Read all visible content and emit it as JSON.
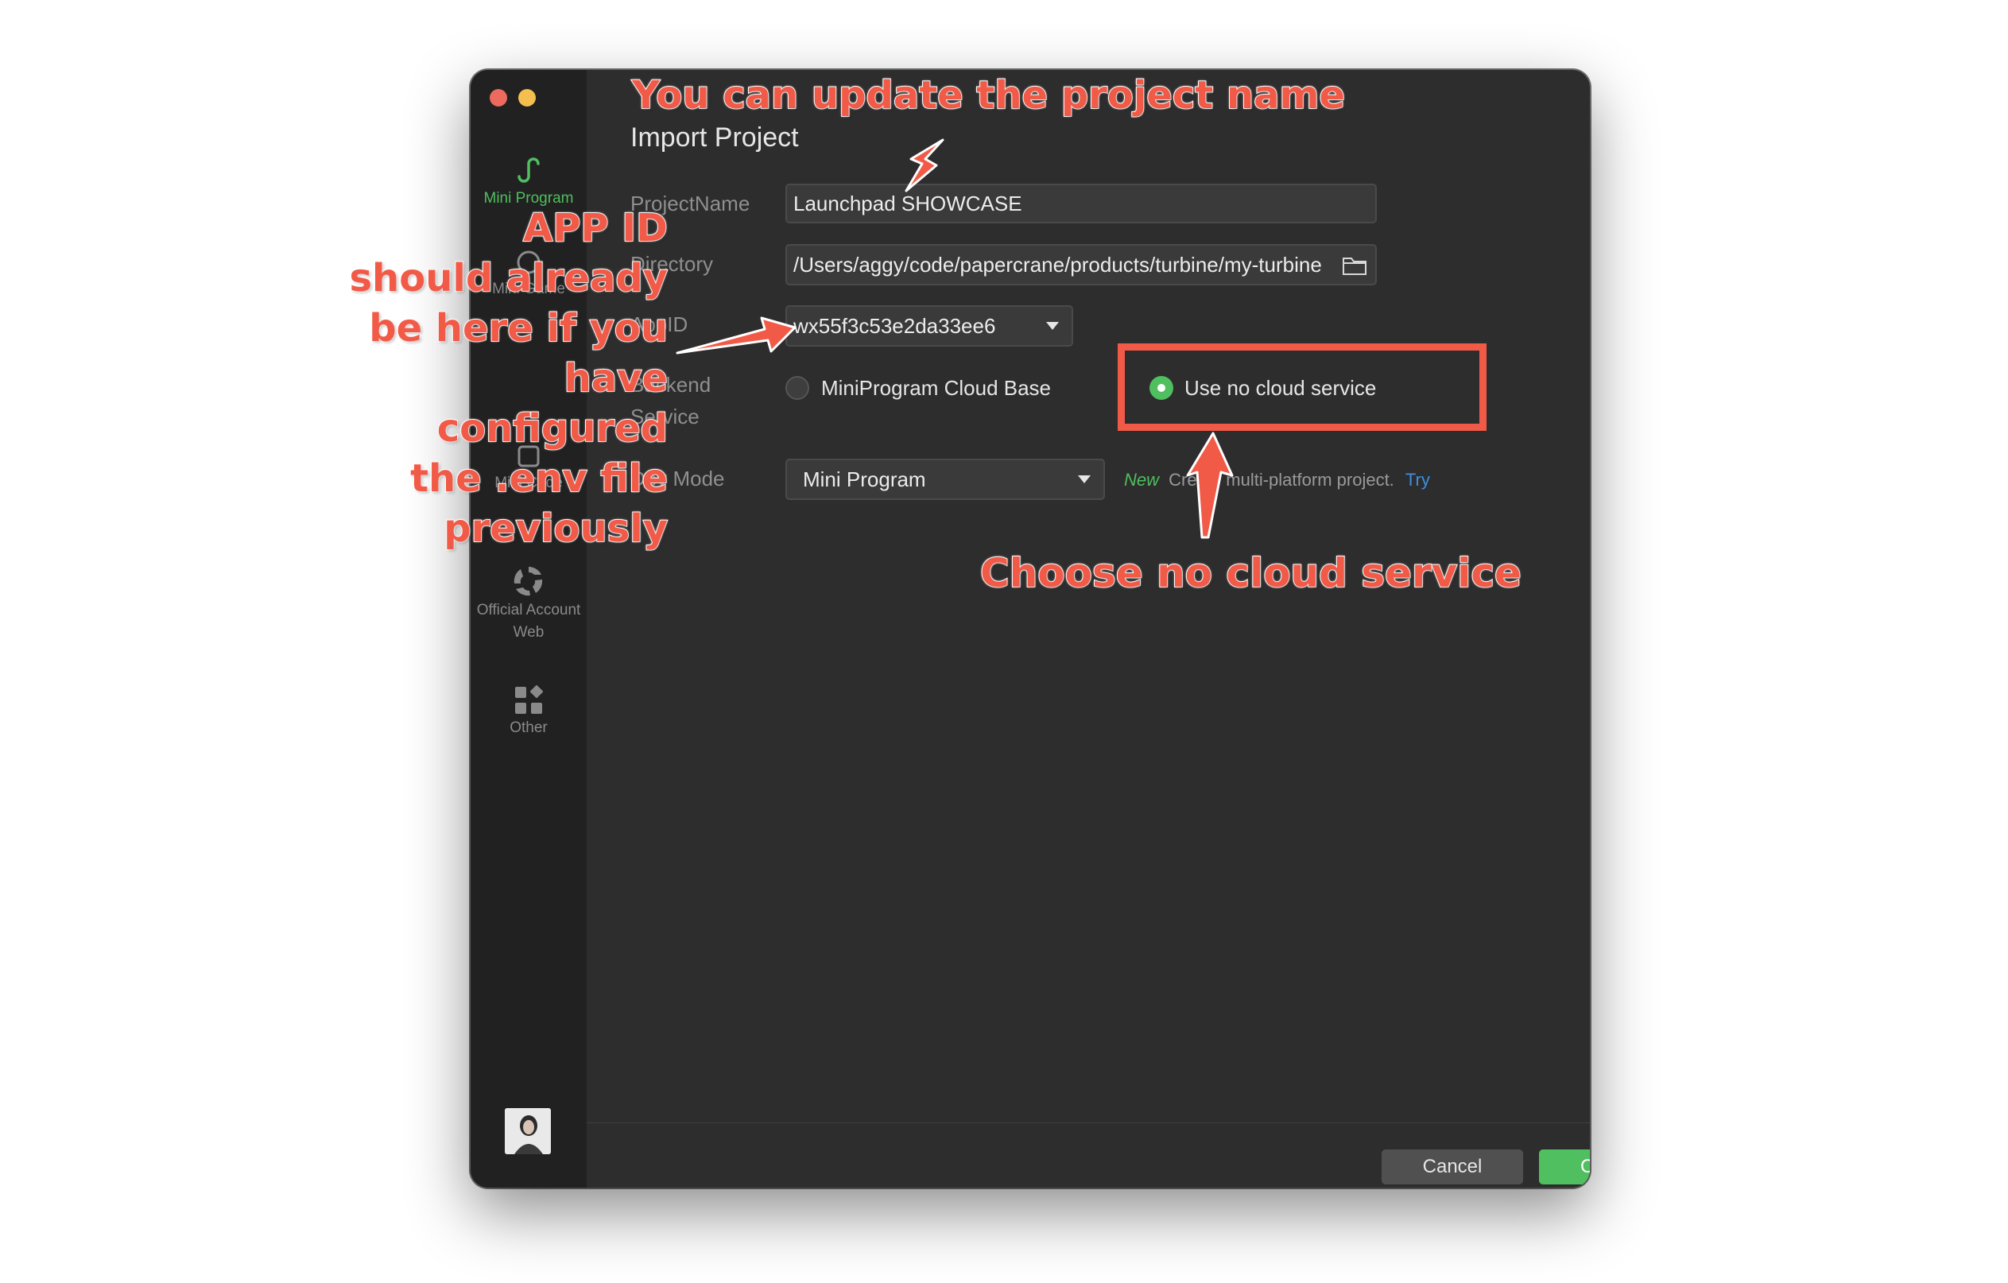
{
  "sidebar": {
    "items": [
      {
        "label": "Mini Program",
        "icon": "mini-program-icon",
        "active": true
      },
      {
        "label": "Mini Game",
        "icon": "mini-game-icon"
      },
      {
        "label": "Mini Code",
        "icon": "mini-code-icon"
      },
      {
        "label": "Official Account Web",
        "icon": "official-account-icon"
      },
      {
        "label": "Other",
        "icon": "grid-icon"
      }
    ]
  },
  "dialog": {
    "title": "Import Project",
    "fields": {
      "project_name_label": "ProjectName",
      "project_name_value": "Launchpad SHOWCASE",
      "directory_label": "Directory",
      "directory_value": "/Users/aggy/code/papercrane/products/turbine/my-turbine",
      "appid_label": "AppID",
      "appid_value": "wx55f3c53e2da33ee6",
      "backend_label_line1": "Backend",
      "backend_label_line2": "Service",
      "backend_option_cloud": "MiniProgram Cloud Base",
      "backend_option_none": "Use no cloud service",
      "dev_mode_label": "Dev Mode",
      "dev_mode_value": "Mini Program",
      "new_badge": "New",
      "new_text": "Create multi-platform project.",
      "try_link": "Try"
    },
    "buttons": {
      "cancel": "Cancel",
      "create": "Create"
    }
  },
  "annotations": {
    "project_name_note": "You can update the project name",
    "appid_note_lines": [
      "APP ID",
      "should already",
      "be here if you",
      "have configured",
      "the .env file",
      "previously"
    ],
    "cloud_note": "Choose no cloud service"
  },
  "colors": {
    "accent_green": "#4fbf5f",
    "annotation_red": "#f25a48",
    "link_blue": "#3d8fe0",
    "window_bg": "#2d2d2d",
    "sidebar_bg": "#212121"
  }
}
